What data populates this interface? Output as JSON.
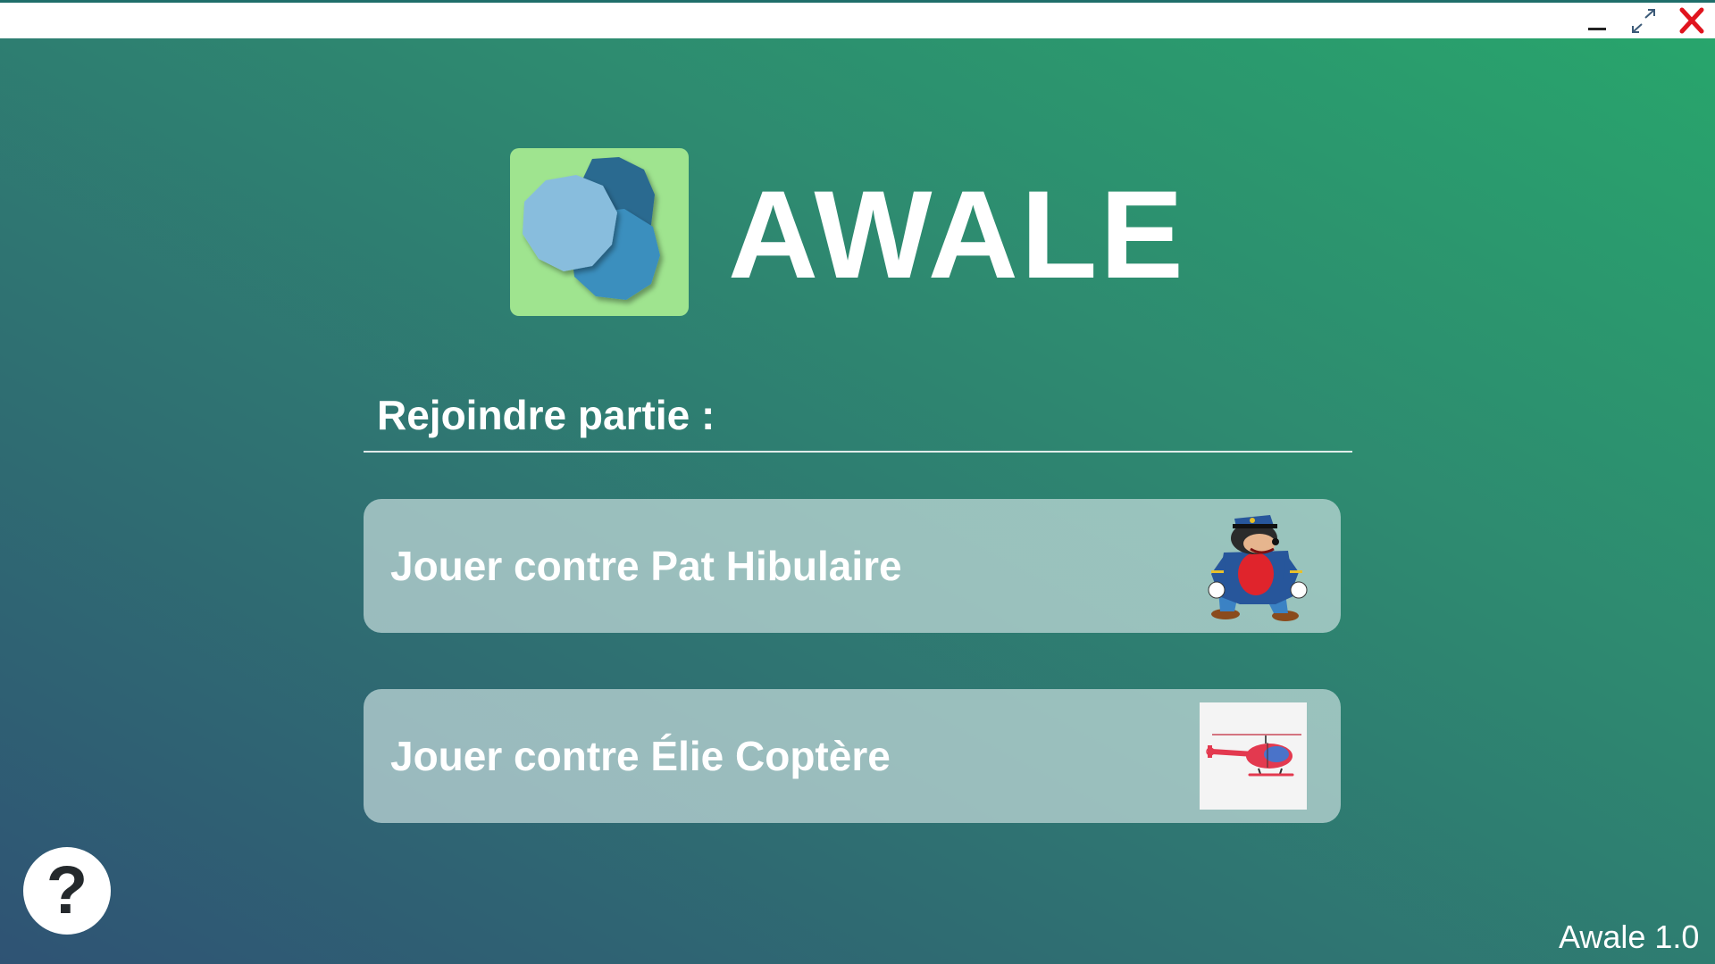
{
  "window": {
    "controls": {
      "minimize": "minimize-icon",
      "maximize": "maximize-icon",
      "close": "close-icon"
    }
  },
  "app": {
    "title": "AWALE",
    "version": "Awale 1.0"
  },
  "join_section": {
    "label": "Rejoindre partie :"
  },
  "opponents": [
    {
      "label": "Jouer contre Pat Hibulaire",
      "avatar": "pat-hibulaire-avatar"
    },
    {
      "label": "Jouer contre Élie Coptère",
      "avatar": "helicopter-avatar"
    }
  ],
  "help": {
    "glyph": "?"
  },
  "colors": {
    "logo_background": "#9fe48f",
    "close_red": "#e0141e",
    "gradient_start": "#2f5374",
    "gradient_end": "#28a56c"
  }
}
